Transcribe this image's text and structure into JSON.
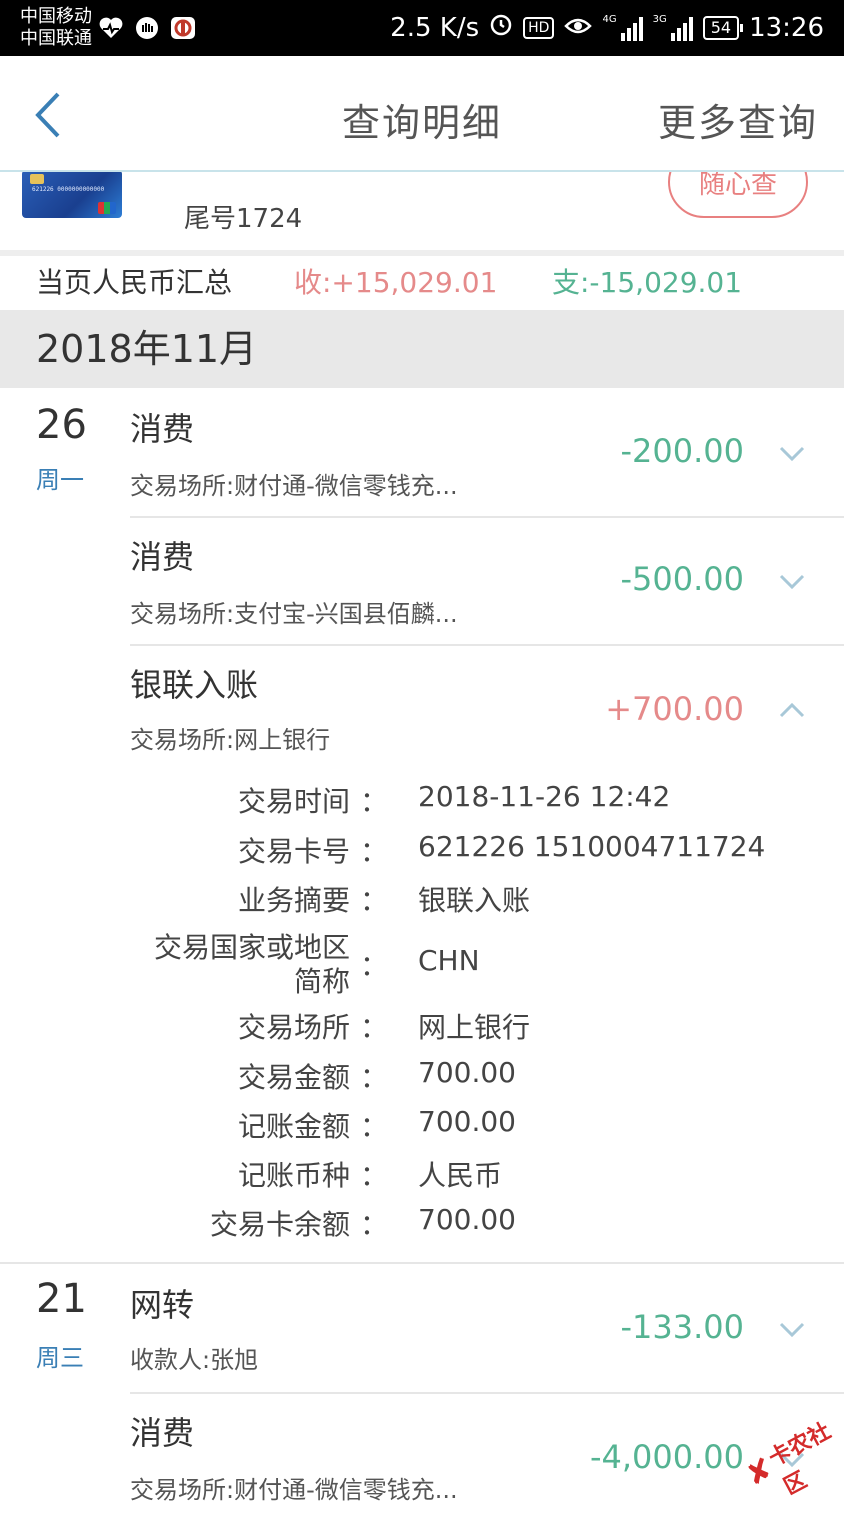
{
  "status_bar": {
    "carrier_1": "中国移动",
    "carrier_2": "中国联通",
    "speed": "2.5 K/s",
    "hd": "HD",
    "net_1": "4G",
    "net_2": "3G",
    "battery": "54",
    "time": "13:26"
  },
  "nav": {
    "title": "查询明细",
    "more": "更多查询"
  },
  "card": {
    "tail": "尾号1724",
    "card_number_print": "621226 0000000000000",
    "random_button": "随心查"
  },
  "summary": {
    "label": "当页人民币汇总",
    "income": "收:+15,029.01",
    "expense": "支:-15,029.01"
  },
  "month": "2018年11月",
  "transactions": [
    {
      "day": "26",
      "weekday": "周一",
      "type": "消费",
      "place": "交易场所:财付通-微信零钱充...",
      "amount": "-200.00",
      "direction": "out",
      "expanded": false
    },
    {
      "day": "",
      "weekday": "",
      "type": "消费",
      "place": "交易场所:支付宝-兴国县佰麟...",
      "amount": "-500.00",
      "direction": "out",
      "expanded": false
    },
    {
      "day": "",
      "weekday": "",
      "type": "银联入账",
      "place": "交易场所:网上银行",
      "amount": "+700.00",
      "direction": "in",
      "expanded": true
    },
    {
      "day": "21",
      "weekday": "周三",
      "type": "网转",
      "place": "收款人:张旭",
      "amount": "-133.00",
      "direction": "out",
      "expanded": false
    },
    {
      "day": "",
      "weekday": "",
      "type": "消费",
      "place": "交易场所:财付通-微信零钱充...",
      "amount": "-4,000.00",
      "direction": "out",
      "expanded": false
    }
  ],
  "details": {
    "colon": "：",
    "rows": [
      {
        "label": "交易时间",
        "value": "2018-11-26 12:42"
      },
      {
        "label": "交易卡号",
        "value": "621226 1510004711724"
      },
      {
        "label": "业务摘要",
        "value": "银联入账"
      },
      {
        "label_line1": "交易国家或地区",
        "label_line2": "简称",
        "value": "CHN"
      },
      {
        "label": "交易场所",
        "value": "网上银行"
      },
      {
        "label": "交易金额",
        "value": "700.00"
      },
      {
        "label": "记账金额",
        "value": "700.00"
      },
      {
        "label": "记账币种",
        "value": "人民币"
      },
      {
        "label": "交易卡余额",
        "value": "700.00"
      }
    ]
  },
  "watermark": {
    "text": "卡农社区",
    "mark": "✘"
  },
  "colors": {
    "income": "#e58a8a",
    "expense": "#55b392",
    "weekday": "#3a7fb5",
    "accent_border": "#c8e3ea"
  }
}
